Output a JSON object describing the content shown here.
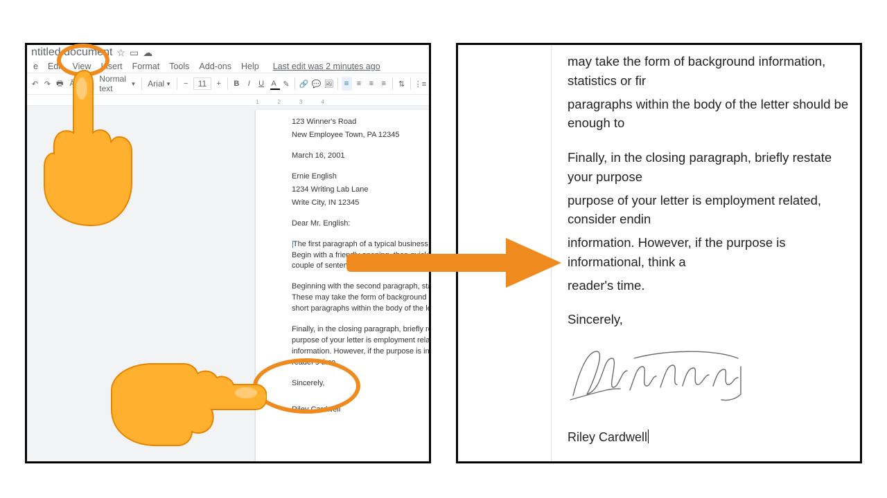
{
  "colors": {
    "accent": "#ee8a1e",
    "blue": "#1a73e8"
  },
  "doc": {
    "title": "ntitled document",
    "menus": [
      "e",
      "Edit",
      "View",
      "Insert",
      "Format",
      "Tools",
      "Add-ons",
      "Help"
    ],
    "last_edit": "Last edit was 2 minutes ago",
    "toolbar": {
      "style": "Normal text",
      "font": "Arial",
      "size": "11"
    },
    "ruler_ticks": [
      "1",
      "2",
      "3",
      "4"
    ]
  },
  "letter": {
    "addr1": "123 Winner's Road",
    "addr2": "New Employee Town, PA 12345",
    "date": "March 16, 2001",
    "to_name": "Ernie English",
    "to_addr1": "1234 Writing Lab Lane",
    "to_addr2": "Write City, IN 12345",
    "salutation": "Dear Mr. English:",
    "p1": "The first paragraph of a typical business letter is used to state the main point of the letter. Begin with a friendly opening, then quickly transition into the purpose of your letter. Use a couple of sentences to explain the purpose, but do not go in to detail until the next paragraph.",
    "p2": "Beginning with the second paragraph, state the supporting details to justify your purpose. These may take the form of background information, statistics or first-hand accounts. A few short paragraphs within the body of the letter should be enough to support your reasoning.",
    "p3": "Finally, in the closing paragraph, briefly restate your purpose and why it is important. If the purpose of your letter is employment related, consider ending your letter with your contact information. However, if the purpose is informational, think about closing with gratitude for the reader's time.",
    "closing": "Sincerely,",
    "sig_name": "Riley Cardwell"
  },
  "right": {
    "l1": "may take the form of background information, statistics or fir",
    "l2": "paragraphs within the body of the letter should be enough to",
    "p2a": "Finally, in the closing paragraph, briefly restate your purpose",
    "p2b": "purpose of your letter is employment related, consider endin",
    "p2c": "information. However, if the purpose is informational, think a",
    "p2d": "reader's time.",
    "closing": "Sincerely,",
    "name": "Riley Cardwell"
  }
}
